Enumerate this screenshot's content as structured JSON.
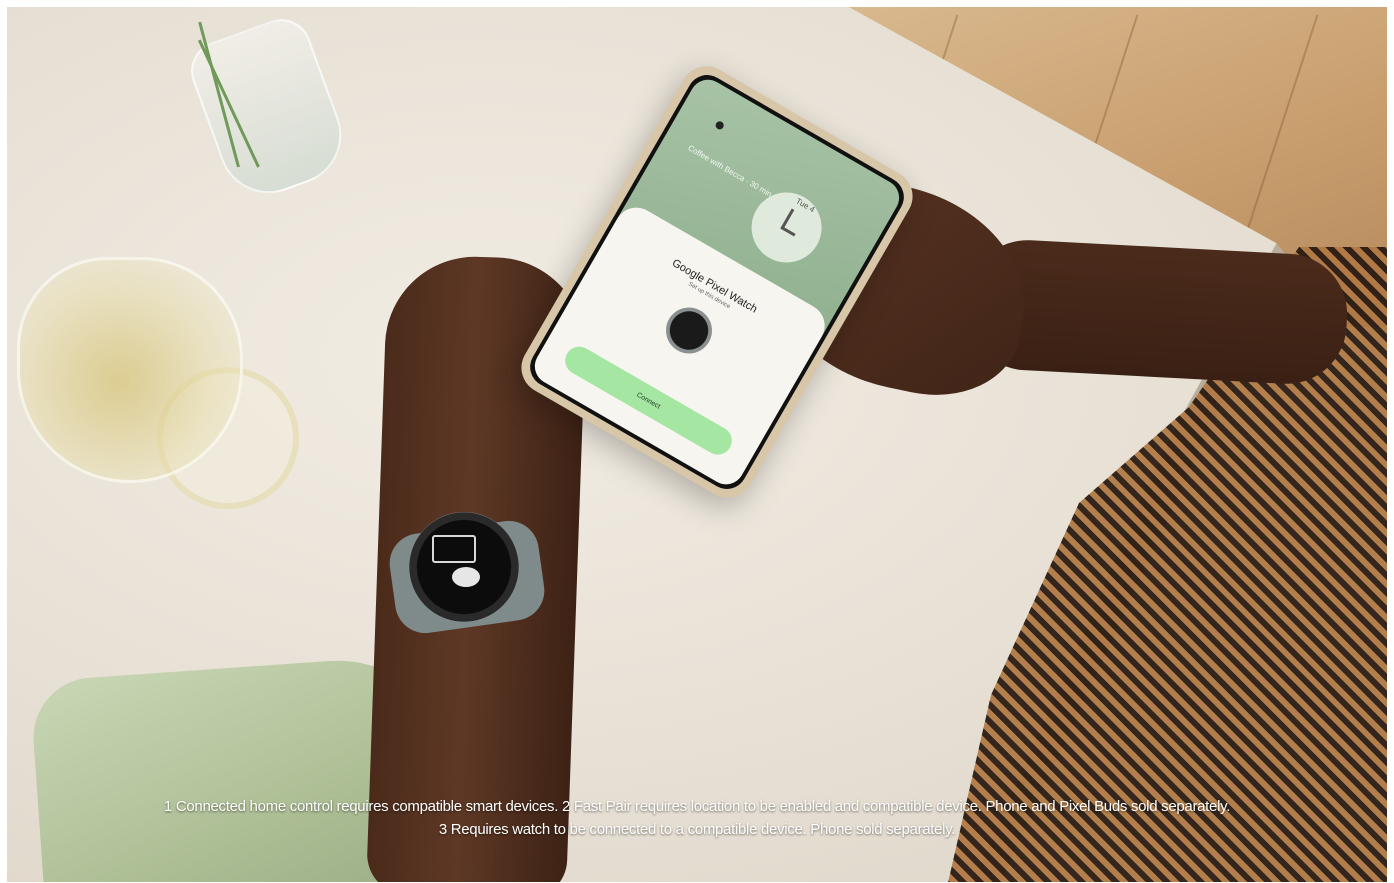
{
  "phone_screen": {
    "status_text": "Coffee with Becca · 30 min",
    "clock_day": "Tue 4",
    "sheet_title": "Google Pixel Watch",
    "sheet_subtitle": "Set up this device",
    "connect_label": "Connect"
  },
  "footnotes": {
    "line1": "1 Connected home control requires compatible smart devices. 2 Fast Pair requires location to be enabled and compatible device. Phone and Pixel Buds sold separately.",
    "line2": "3 Requires watch to be connected to a compatible device. Phone sold separately."
  },
  "colors": {
    "button_green": "#a6e6a3",
    "wallpaper_green": "#a8c3a6",
    "caption_text": "#ffffff"
  }
}
